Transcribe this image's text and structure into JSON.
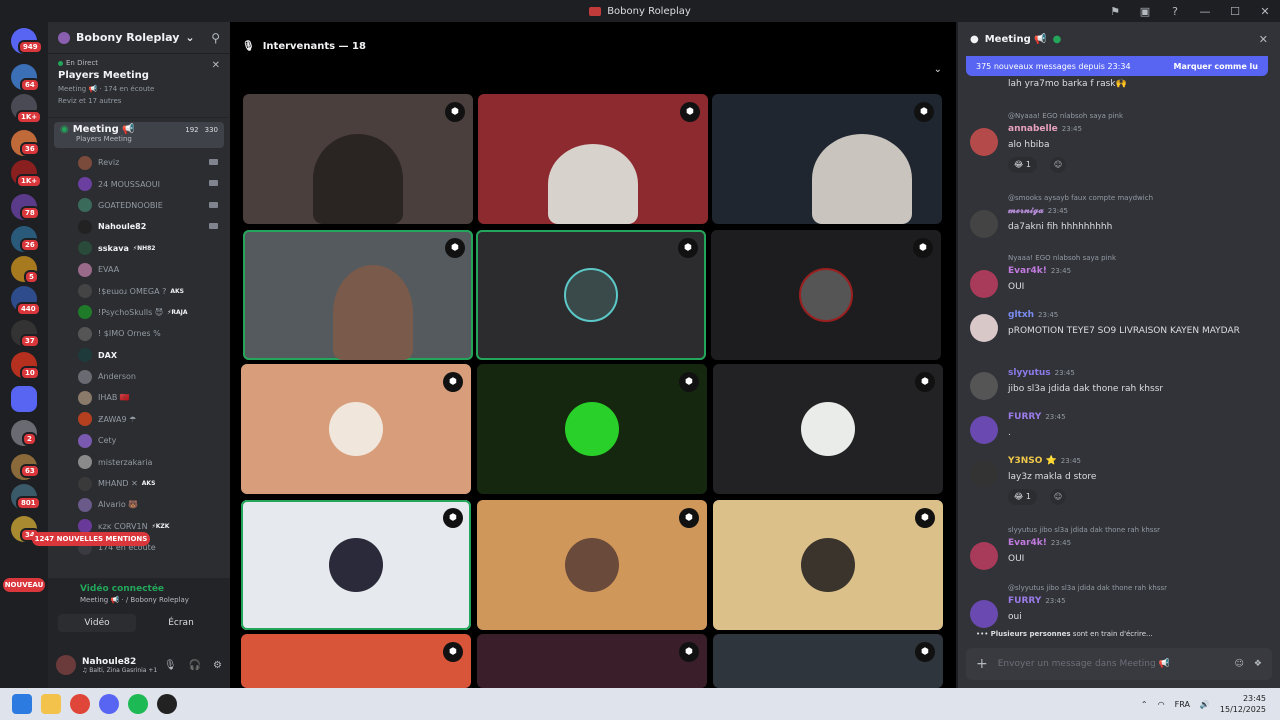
{
  "titlebar": {
    "title": "Bobony Roleplay"
  },
  "servers": {
    "badges": [
      "949",
      "64",
      "1K+",
      "36",
      "1K+",
      "78",
      "26",
      "5",
      "440",
      "37",
      "10",
      "2",
      "63",
      "801",
      "34"
    ],
    "nouveau": "NOUVEAU"
  },
  "guild": {
    "name": "Bobony Roleplay"
  },
  "event": {
    "live": "En Direct",
    "title": "Players Meeting",
    "meta": "Meeting 📢 · 174 en écoute",
    "others": "Reviz et 17 autres"
  },
  "voice_channel": {
    "name": "Meeting 📢",
    "sub": "Players Meeting",
    "count_video": "192",
    "count_listen": "330"
  },
  "members": [
    {
      "name": "Reviz",
      "bold": false,
      "tag": ""
    },
    {
      "name": "24 MOUSSAOUI",
      "bold": false,
      "tag": ""
    },
    {
      "name": "GOATEDNOOBIE",
      "bold": false,
      "tag": ""
    },
    {
      "name": "Nahoule82",
      "bold": true,
      "tag": ""
    },
    {
      "name": "sskava",
      "bold": true,
      "tag": "⚡NH82"
    },
    {
      "name": "EVAA",
      "bold": false,
      "tag": ""
    },
    {
      "name": "!$ɐɯoɹ OMEGA ?",
      "bold": false,
      "tag": "AKS"
    },
    {
      "name": "!PsychoSkulls 😈",
      "bold": false,
      "tag": "⚡RAJA"
    },
    {
      "name": "! $IMO Ornes %",
      "bold": false,
      "tag": ""
    },
    {
      "name": "DAX",
      "bold": true,
      "tag": ""
    },
    {
      "name": "Anderson",
      "bold": false,
      "tag": ""
    },
    {
      "name": "IHAB 🇲🇦",
      "bold": false,
      "tag": ""
    },
    {
      "name": "ƵAWA9 ☂",
      "bold": false,
      "tag": ""
    },
    {
      "name": "Cety",
      "bold": false,
      "tag": ""
    },
    {
      "name": "misterzakaria",
      "bold": false,
      "tag": ""
    },
    {
      "name": "MHAND ✕",
      "bold": false,
      "tag": "AKS"
    },
    {
      "name": "Alvario 🐻",
      "bold": false,
      "tag": ""
    },
    {
      "name": "ᴋᴢᴋ CORV1N",
      "bold": false,
      "tag": "⚡KZK"
    },
    {
      "name": "174 en écoute",
      "bold": false,
      "tag": ""
    }
  ],
  "mentions": "1247 NOUVELLES MENTIONS",
  "voice_connected": {
    "status": "Vidéo connectée",
    "location": "Meeting 📢 · / Bobony Roleplay",
    "video_btn": "Vidéo",
    "screen_btn": "Écran"
  },
  "user": {
    "name": "Nahoule82",
    "status": "♫ Balti, Zina Gasrinia +1"
  },
  "stage": {
    "header": "Intervenants — 18"
  },
  "chat": {
    "title": "Meeting 📢",
    "new_messages": "375 nouveaux messages depuis 23:34",
    "mark_read": "Marquer comme lu",
    "messages": [
      {
        "reply": "",
        "author": "",
        "time": "",
        "text": "lah yra7mo barka f rask🙌",
        "color": "#dbdee1"
      },
      {
        "reply": "@Nyaaa! EGO nlabsoh saya pink",
        "author": "annabelle",
        "time": "23:45",
        "text": "alo hbiba",
        "color": "#e8a0c0"
      },
      {
        "reply": "@smooks aysayb faux compte maydwich",
        "author": "𝓶𝓮𝓻𝓷𝓲𝓰𝓪",
        "time": "23:45",
        "text": "da7akni fih hhhhhhhhh",
        "color": "#b58cd6"
      },
      {
        "reply": "Nyaaa! EGO nlabsoh saya pink",
        "author": "Evar4k!",
        "time": "23:45",
        "text": "OUI",
        "color": "#c27ae0"
      },
      {
        "reply": "",
        "author": "gltxh",
        "time": "23:45",
        "text": "pROMOTION TEYE7 SO9 LIVRAISON KAYEN MAYDAR",
        "color": "#7b8bf0"
      },
      {
        "reply": "",
        "author": "slyyutus",
        "time": "23:45",
        "text": "jibo sl3a jdida dak thone rah khssr",
        "color": "#8a7be8"
      },
      {
        "reply": "",
        "author": "FURRY",
        "time": "23:45",
        "text": ".",
        "color": "#9a7be8"
      },
      {
        "reply": "",
        "author": "Y3NSO ⭐",
        "time": "23:45",
        "text": "lay3z makla d store",
        "color": "#f0c94a"
      },
      {
        "reply": "slyyutus jibo sl3a jdida dak thone rah khssr",
        "author": "Evar4k!",
        "time": "23:45",
        "text": "OUI",
        "color": "#c27ae0"
      },
      {
        "reply": "@slyyutus jibo sl3a jdida dak thone rah khssr",
        "author": "FURRY",
        "time": "23:45",
        "text": "oui",
        "color": "#9a7be8"
      }
    ],
    "reactions": {
      "count1": "1",
      "count2": "1"
    },
    "typing_who": "Plusieurs personnes",
    "typing_rest": "sont en train d'écrire...",
    "input_placeholder": "Envoyer un message dans Meeting 📢"
  },
  "taskbar": {
    "lang": "FRA",
    "time": "23:45",
    "date": "15/12/2025"
  },
  "colors": {
    "accent": "#5865f2",
    "online": "#23a55a",
    "alert": "#da373c"
  }
}
